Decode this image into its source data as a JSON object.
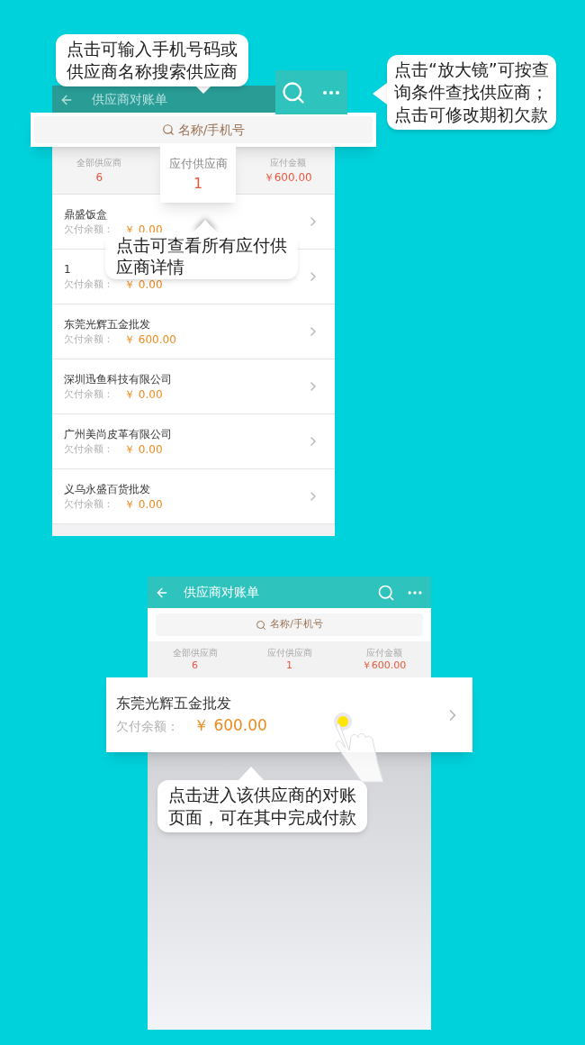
{
  "screen_1": {
    "title": "供应商对账单",
    "search": {
      "placeholder": "名称/手机号"
    },
    "stats": [
      {
        "label": "全部供应商",
        "value": "6",
        "highlighted": false
      },
      {
        "label": "应付供应商",
        "value": "1",
        "highlighted": true
      },
      {
        "label": "应付金额",
        "value": "￥600.00",
        "highlighted": false
      }
    ],
    "rows": [
      {
        "name": "鼎盛饭盒",
        "label": "欠付余额：",
        "amount": "￥ 0.00"
      },
      {
        "name": "1",
        "label": "欠付余额：",
        "amount": "￥ 0.00"
      },
      {
        "name": "东莞光辉五金批发",
        "label": "欠付余额：",
        "amount": "￥ 600.00"
      },
      {
        "name": "深圳迅鱼科技有限公司",
        "label": "欠付余额：",
        "amount": "￥ 0.00"
      },
      {
        "name": "广州美尚皮革有限公司",
        "label": "欠付余额：",
        "amount": "￥ 0.00"
      },
      {
        "name": "义乌永盛百货批发",
        "label": "欠付余额：",
        "amount": "￥ 0.00"
      }
    ]
  },
  "screen_2": {
    "title": "供应商对账单",
    "search": {
      "placeholder": "名称/手机号"
    },
    "stats": [
      {
        "label": "全部供应商",
        "value": "6"
      },
      {
        "label": "应付供应商",
        "value": "1"
      },
      {
        "label": "应付金额",
        "value": "￥600.00"
      }
    ],
    "row": {
      "name": "东莞光辉五金批发",
      "label": "欠付余额：",
      "amount": "￥ 600.00"
    }
  },
  "callouts": [
    {
      "lines": [
        "点击可输入手机号码或",
        "供应商名称搜索供应商"
      ]
    },
    {
      "lines": [
        "点击“放大镜”可按查",
        "询条件查找供应商；",
        "点击可修改期初欠款"
      ]
    },
    {
      "lines": [
        "点击可查看所有应付供",
        "应商详情"
      ]
    },
    {
      "lines": [
        "点击进入该供应商的对账",
        "页面，可在其中完成付款"
      ]
    }
  ]
}
